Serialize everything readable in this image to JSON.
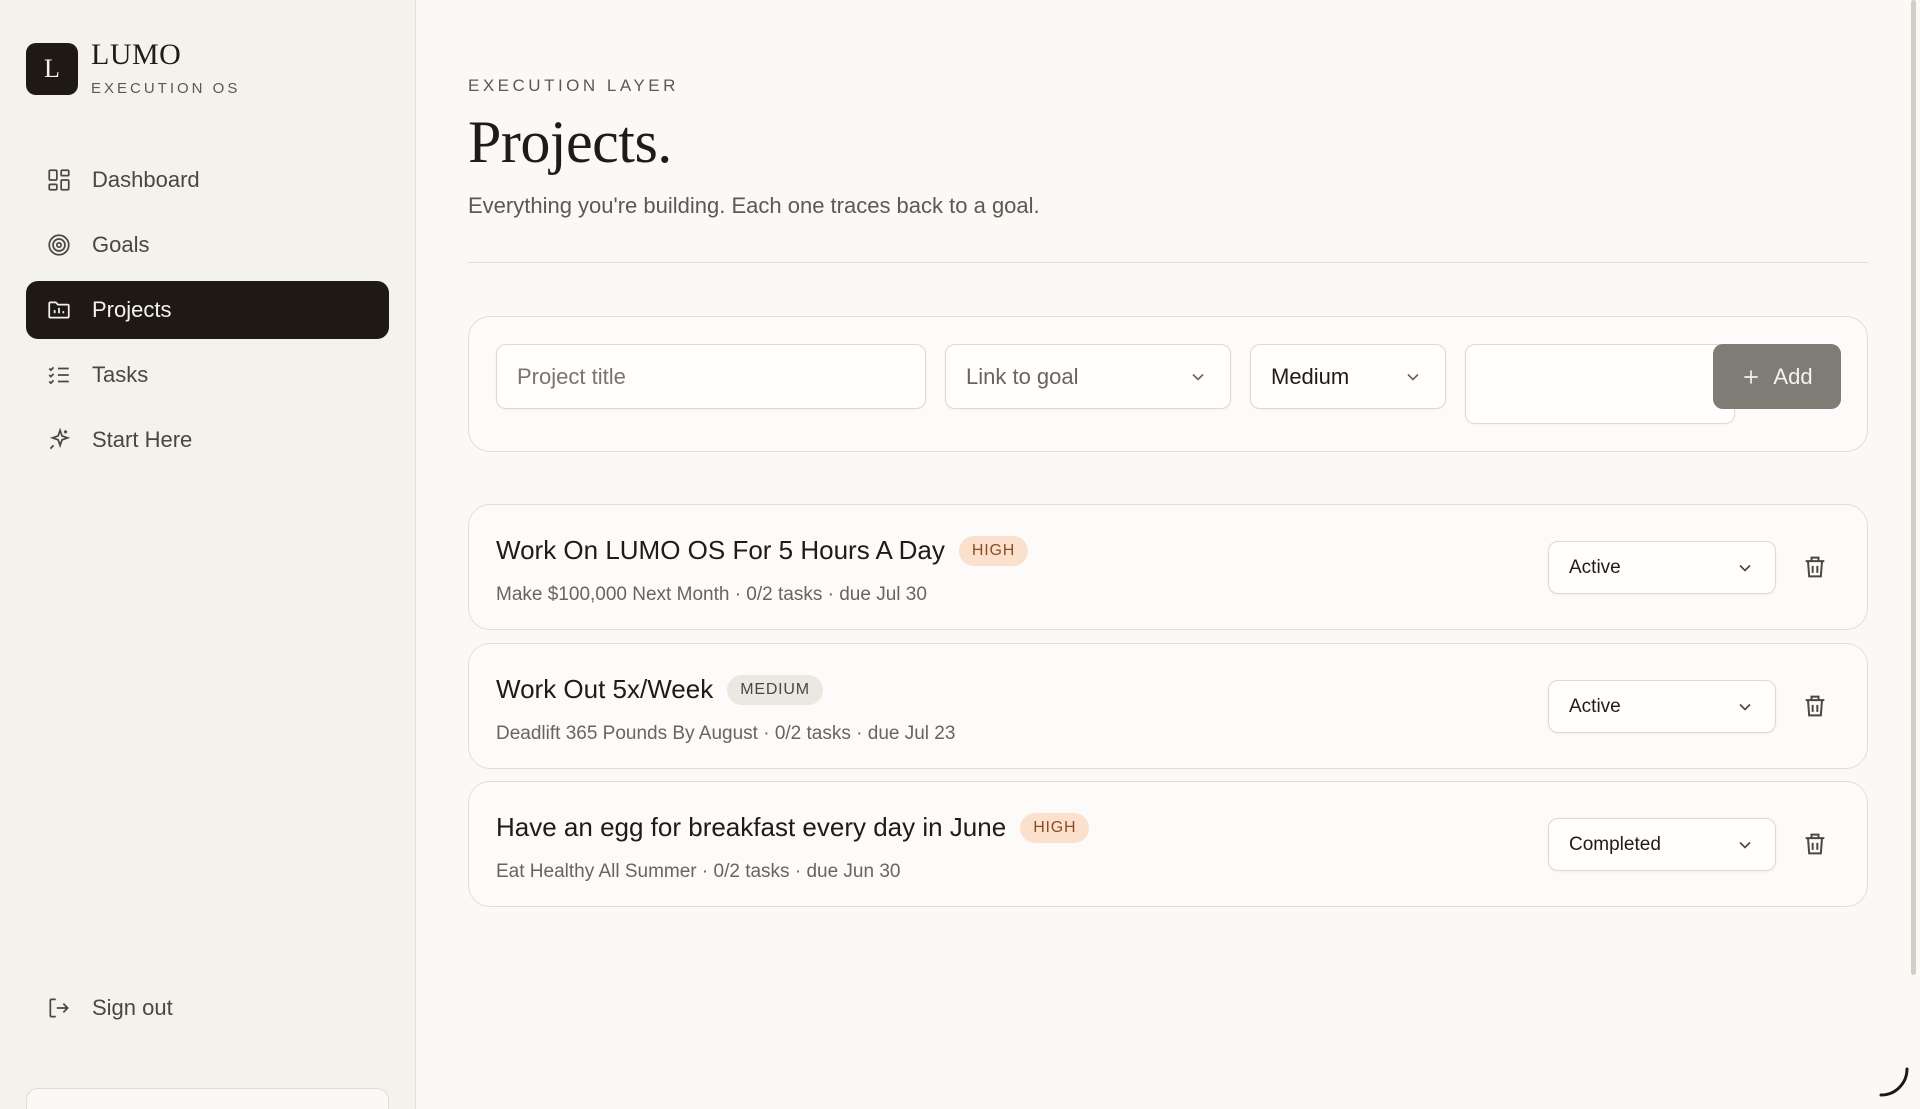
{
  "brand": {
    "logo_letter": "L",
    "name": "LUMO",
    "subtitle": "EXECUTION OS"
  },
  "nav": {
    "items": [
      {
        "label": "Dashboard",
        "icon": "dashboard-icon",
        "active": false
      },
      {
        "label": "Goals",
        "icon": "target-icon",
        "active": false
      },
      {
        "label": "Projects",
        "icon": "folder-icon",
        "active": true
      },
      {
        "label": "Tasks",
        "icon": "checklist-icon",
        "active": false
      },
      {
        "label": "Start Here",
        "icon": "sparkle-icon",
        "active": false
      }
    ],
    "signout_label": "Sign out"
  },
  "header": {
    "eyebrow": "EXECUTION LAYER",
    "title": "Projects.",
    "subtitle": "Everything you're building. Each one traces back to a goal."
  },
  "form": {
    "title_placeholder": "Project title",
    "goal_value": "Link to goal",
    "priority_value": "Medium",
    "date_value": "",
    "add_label": "Add"
  },
  "projects": [
    {
      "title": "Work On LUMO OS For 5 Hours A Day",
      "priority": "HIGH",
      "meta": "Make $100,000 Next Month · 0/2 tasks · due Jul 30",
      "status": "Active"
    },
    {
      "title": "Work Out 5x/Week",
      "priority": "MEDIUM",
      "meta": "Deadlift 365 Pounds By August · 0/2 tasks · due Jul 23",
      "status": "Active"
    },
    {
      "title": "Have an egg for breakfast every day in June",
      "priority": "HIGH",
      "meta": "Eat Healthy All Summer · 0/2 tasks · due Jun 30",
      "status": "Completed"
    }
  ],
  "colors": {
    "accent_dark": "#1e1914",
    "badge_high_bg": "#fbe1cd",
    "badge_medium_bg": "#ebe8e2",
    "add_button_bg": "#7f7c76"
  }
}
